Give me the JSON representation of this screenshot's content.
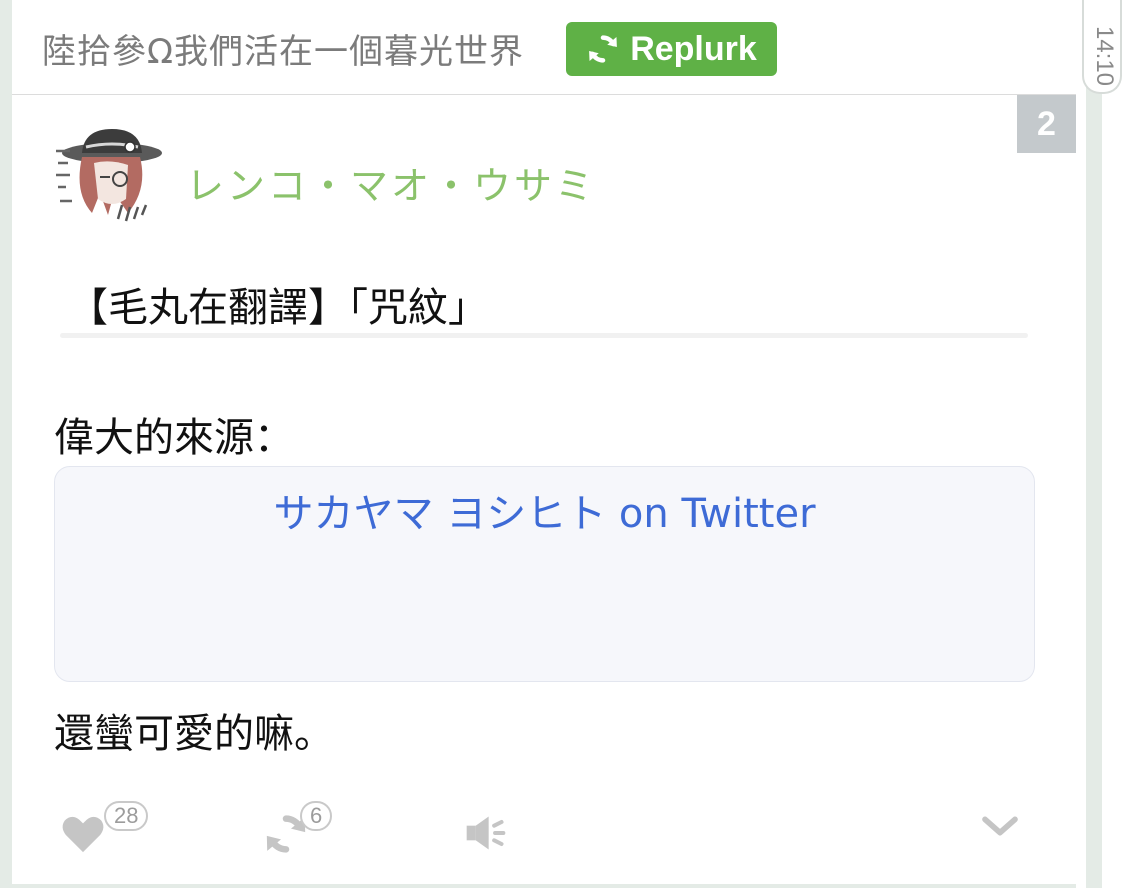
{
  "header": {
    "title": "陸拾參Ω我們活在一個暮光世界",
    "replurk_label": "Replurk",
    "replurk_icon": "refresh-icon",
    "replurk_color": "#5fb146"
  },
  "timeline": {
    "time": "14:10"
  },
  "post": {
    "response_count": "2",
    "author": {
      "name": "レンコ・マオ・ウサミ",
      "color": "#8bc26b",
      "avatar": "avatar-image"
    },
    "title": "【毛丸在翻譯】「咒紋」",
    "source_label": "偉大的來源：",
    "link": {
      "text": "サカヤマ ヨシヒト on Twitter",
      "color": "#3e6bd6"
    },
    "ending": "還蠻可愛的嘛。"
  },
  "actions": {
    "like": {
      "icon": "heart-icon",
      "count": "28"
    },
    "replurk": {
      "icon": "replurk-icon",
      "count": "6"
    },
    "mute": {
      "icon": "speaker-icon"
    },
    "more": {
      "icon": "chevron-down-icon"
    }
  }
}
